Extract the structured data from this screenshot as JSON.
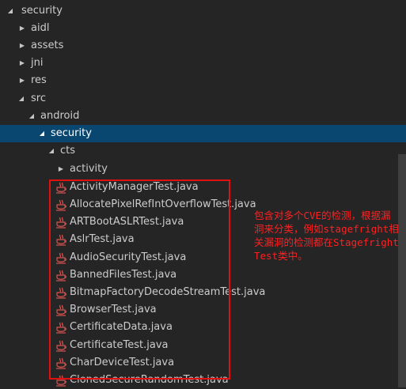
{
  "explorer": {
    "root": {
      "label": "security"
    },
    "folders_level1": [
      {
        "label": "aidl"
      },
      {
        "label": "assets"
      },
      {
        "label": "jni"
      },
      {
        "label": "res"
      },
      {
        "label": "src"
      }
    ],
    "android": {
      "label": "android"
    },
    "security_pkg": {
      "label": "security"
    },
    "cts": {
      "label": "cts"
    },
    "activity": {
      "label": "activity"
    },
    "files": [
      {
        "label": "ActivityManagerTest.java"
      },
      {
        "label": "AllocatePixelRefIntOverflowTest.java"
      },
      {
        "label": "ARTBootASLRTest.java"
      },
      {
        "label": "AslrTest.java"
      },
      {
        "label": "AudioSecurityTest.java"
      },
      {
        "label": "BannedFilesTest.java"
      },
      {
        "label": "BitmapFactoryDecodeStreamTest.java"
      },
      {
        "label": "BrowserTest.java"
      },
      {
        "label": "CertificateData.java"
      },
      {
        "label": "CertificateTest.java"
      },
      {
        "label": "CharDeviceTest.java"
      },
      {
        "label": "ClonedSecureRandomTest.java"
      }
    ]
  },
  "annotation": {
    "text": "包含对多个CVE的检测，根据漏洞来分类，例如stagefright相关漏洞的检测都在StagefrightTest类中。"
  },
  "colors": {
    "background": "#252526",
    "selection": "#094771",
    "annotation": "#ff2020"
  },
  "icons": {
    "expanded": "triangle-down-icon",
    "collapsed": "triangle-right-icon",
    "java_file": "java-coffee-cup-icon"
  }
}
